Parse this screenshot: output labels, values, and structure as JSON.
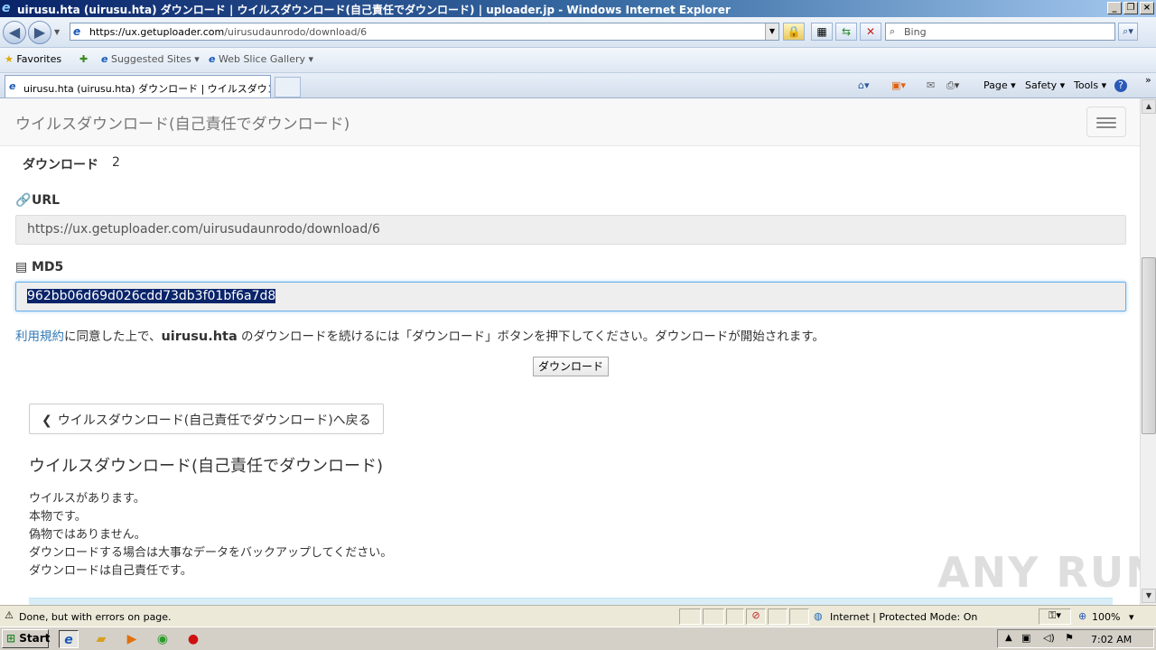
{
  "window": {
    "title": "uirusu.hta (uirusu.hta) ダウンロード | ウイルスダウンロード(自己責任でダウンロード) | uploader.jp - Windows Internet Explorer"
  },
  "address": {
    "url_prefix": "https://ux.",
    "url_host": "getuploader.com",
    "url_path": "/uirusudaunrodo/download/6"
  },
  "search": {
    "placeholder": "Bing"
  },
  "favorites": {
    "label": "Favorites",
    "suggested": "Suggested Sites ▾",
    "gallery": "Web Slice Gallery ▾"
  },
  "tab": {
    "label": "uirusu.hta (uirusu.hta) ダウンロード | ウイルスダウンロ..."
  },
  "commands": {
    "page": "Page ▾",
    "safety": "Safety ▾",
    "tools": "Tools ▾",
    "help": "?"
  },
  "page": {
    "brand": "ウイルスダウンロード(自己責任でダウンロード)",
    "download_label": "ダウンロード",
    "download_count": "2",
    "url_label": "URL",
    "url_value": "https://ux.getuploader.com/uirusudaunrodo/download/6",
    "md5_label": "MD5",
    "md5_value": "962bb06d69d026cdd73db3f01bf6a7d8",
    "notice_link": "利用規約",
    "notice_mid": "に同意した上で、",
    "notice_file": "uirusu.hta",
    "notice_rest": " のダウンロードを続けるには「ダウンロード」ボタンを押下してください。ダウンロードが開始されます。",
    "download_button": "ダウンロード",
    "back_button": "ウイルスダウンロード(自己責任でダウンロード)へ戻る",
    "subtitle": "ウイルスダウンロード(自己責任でダウンロード)",
    "desc_lines": [
      "ウイルスがあります。",
      "本物です。",
      "偽物ではありません。",
      "ダウンロードする場合は大事なデータをバックアップしてください。",
      "ダウンロードは自己責任です。"
    ]
  },
  "watermark": "ANY RUN",
  "status": {
    "text": "Done, but with errors on page.",
    "zone": "Internet | Protected Mode: On",
    "zoom": "100%"
  },
  "taskbar": {
    "start": "Start",
    "clock": "7:02 AM"
  },
  "colors": {
    "link": "#337ab7",
    "selection": "#0a246a",
    "focus_border": "#66afe9"
  }
}
